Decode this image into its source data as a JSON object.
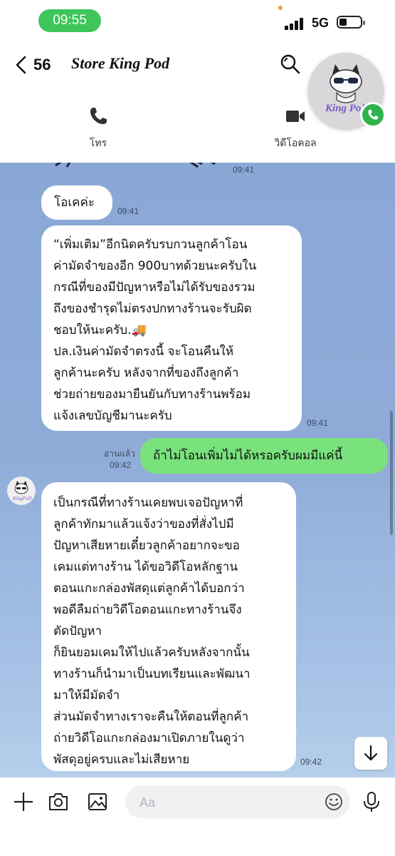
{
  "status_bar": {
    "time": "09:55",
    "network": "5G"
  },
  "header": {
    "unread_count": "56",
    "title": "Store King Pod",
    "call_label": "โทร",
    "video_call_label": "วิดีโอคอล",
    "avatar_brand": "King PoD"
  },
  "messages": [
    {
      "type": "clipped",
      "time": "09:41"
    },
    {
      "type": "incoming",
      "text": "โอเคค่ะ",
      "time": "09:41"
    },
    {
      "type": "incoming",
      "text": "“เพิ่มเติม”อีกนิดครับรบกวนลูกค้าโอน\nค่ามัดจำของอีก 900บาทด้วยนะครับใน\nกรณีที่ของมีปัญหาหรือไม่ได้รับของรวม\nถึงของชำรุดไม่ตรงปกทางร้านจะรับผิด\nชอบให้นะครับ.🚚\nปล.เงินค่ามัดจำตรงนี้ จะโอนคืนให้\nลูกค้านะครับ หลังจากที่ของถึงลูกค้า\nช่วยถ่ายของมายืนยันกับทางร้านพร้อม\nแจ้งเลขบัญชีมานะครับ",
      "time": "09:41"
    },
    {
      "type": "outgoing",
      "text": "ถ้าไม่โอนเพิ่มไม่ได้หรอครับผมมีแค่นี้",
      "read_label": "อ่านแล้ว",
      "time": "09:42"
    },
    {
      "type": "incoming",
      "text": "เป็นกรณีที่ทางร้านเคยพบเจอปัญหาที่\nลูกค้าทักมาแล้วแจ้งว่าของที่สั่งไปมี\nปัญหาเสียหายเดี๋ยวลูกค้าอยากจะขอ\nเคมแต่ทางร้าน ได้ขอวิดีโอหลักฐาน\nตอนแกะกล่องพัสดุแต่ลูกค้าได้บอกว่า\nพอดีลืมถ่ายวิดีโอตอนแกะทางร้านจึง\nตัดปัญหา\nก็ยินยอมเคมให้ไปแล้วครับหลังจากนั้น\nทางร้านก็นำมาเป็นบทเรียนและพัฒนา\nมาให้มีมัดจำ\nส่วนมัดจำทางเราจะคืนให้ตอนที่ลูกค้า\nถ่ายวิดีโอแกะกล่องมาเปิดภายในดูว่า\nพัสดุอยู่ครบและไม่เสียหาย",
      "time": "09:42"
    }
  ],
  "input": {
    "placeholder": "Aa"
  },
  "icons": {
    "back": "chevron-left-icon",
    "search": "search-icon",
    "phone": "phone-icon",
    "video": "video-camera-icon",
    "add": "plus-icon",
    "camera": "camera-icon",
    "gallery": "image-icon",
    "emoji": "emoji-icon",
    "mic": "microphone-icon",
    "scroll": "arrow-down-icon"
  },
  "colors": {
    "status_pill": "#3ec65a",
    "chat_bg": "#8eabd8",
    "outgoing_bubble": "#79e27c",
    "call_green": "#2fb34c"
  }
}
